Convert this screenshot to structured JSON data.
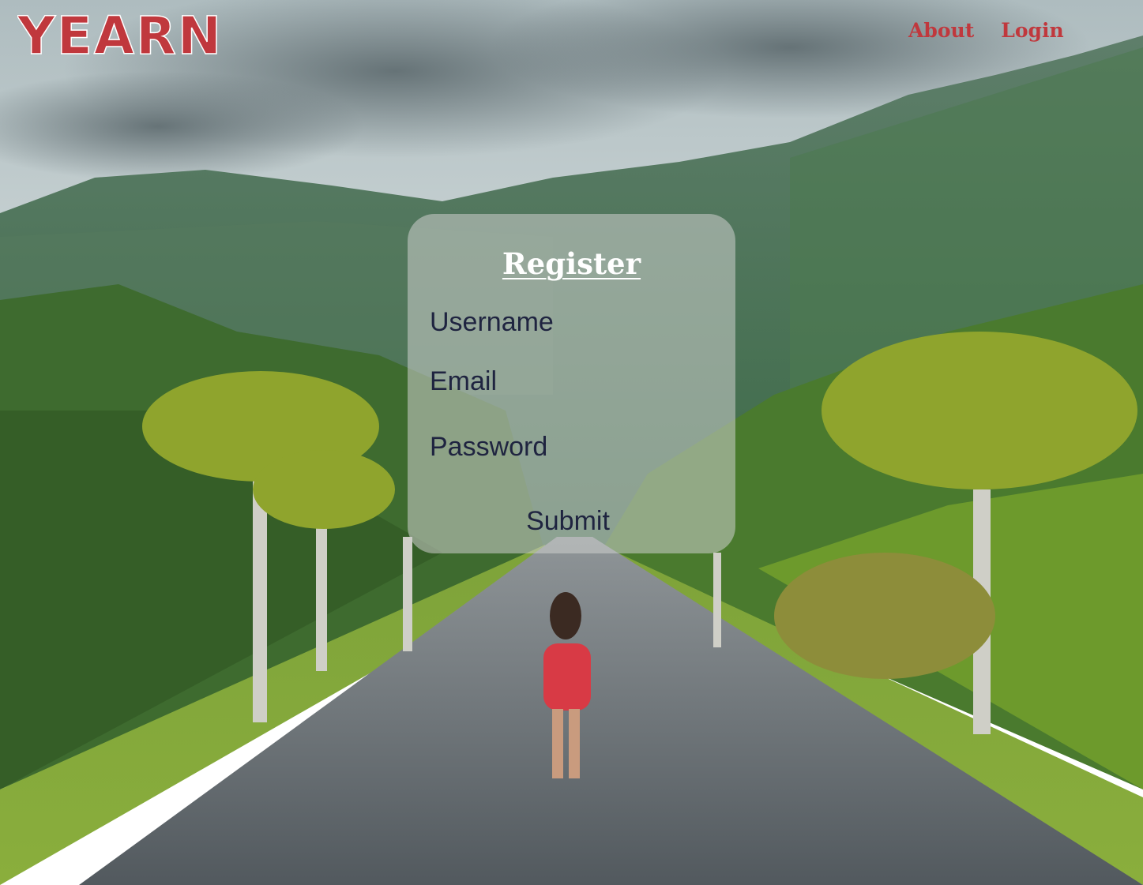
{
  "brand": {
    "logo_text": "YEARN"
  },
  "nav": {
    "about_label": "About",
    "login_label": "Login"
  },
  "register": {
    "title": "Register",
    "username_placeholder": "Username",
    "email_placeholder": "Email",
    "password_placeholder": "Password",
    "submit_label": "Submit"
  },
  "colors": {
    "brand_red": "#c0383d",
    "field_text": "#1f2440",
    "title_text": "#ffffff"
  },
  "icons": {
    "background": "tropical-road-photo"
  }
}
